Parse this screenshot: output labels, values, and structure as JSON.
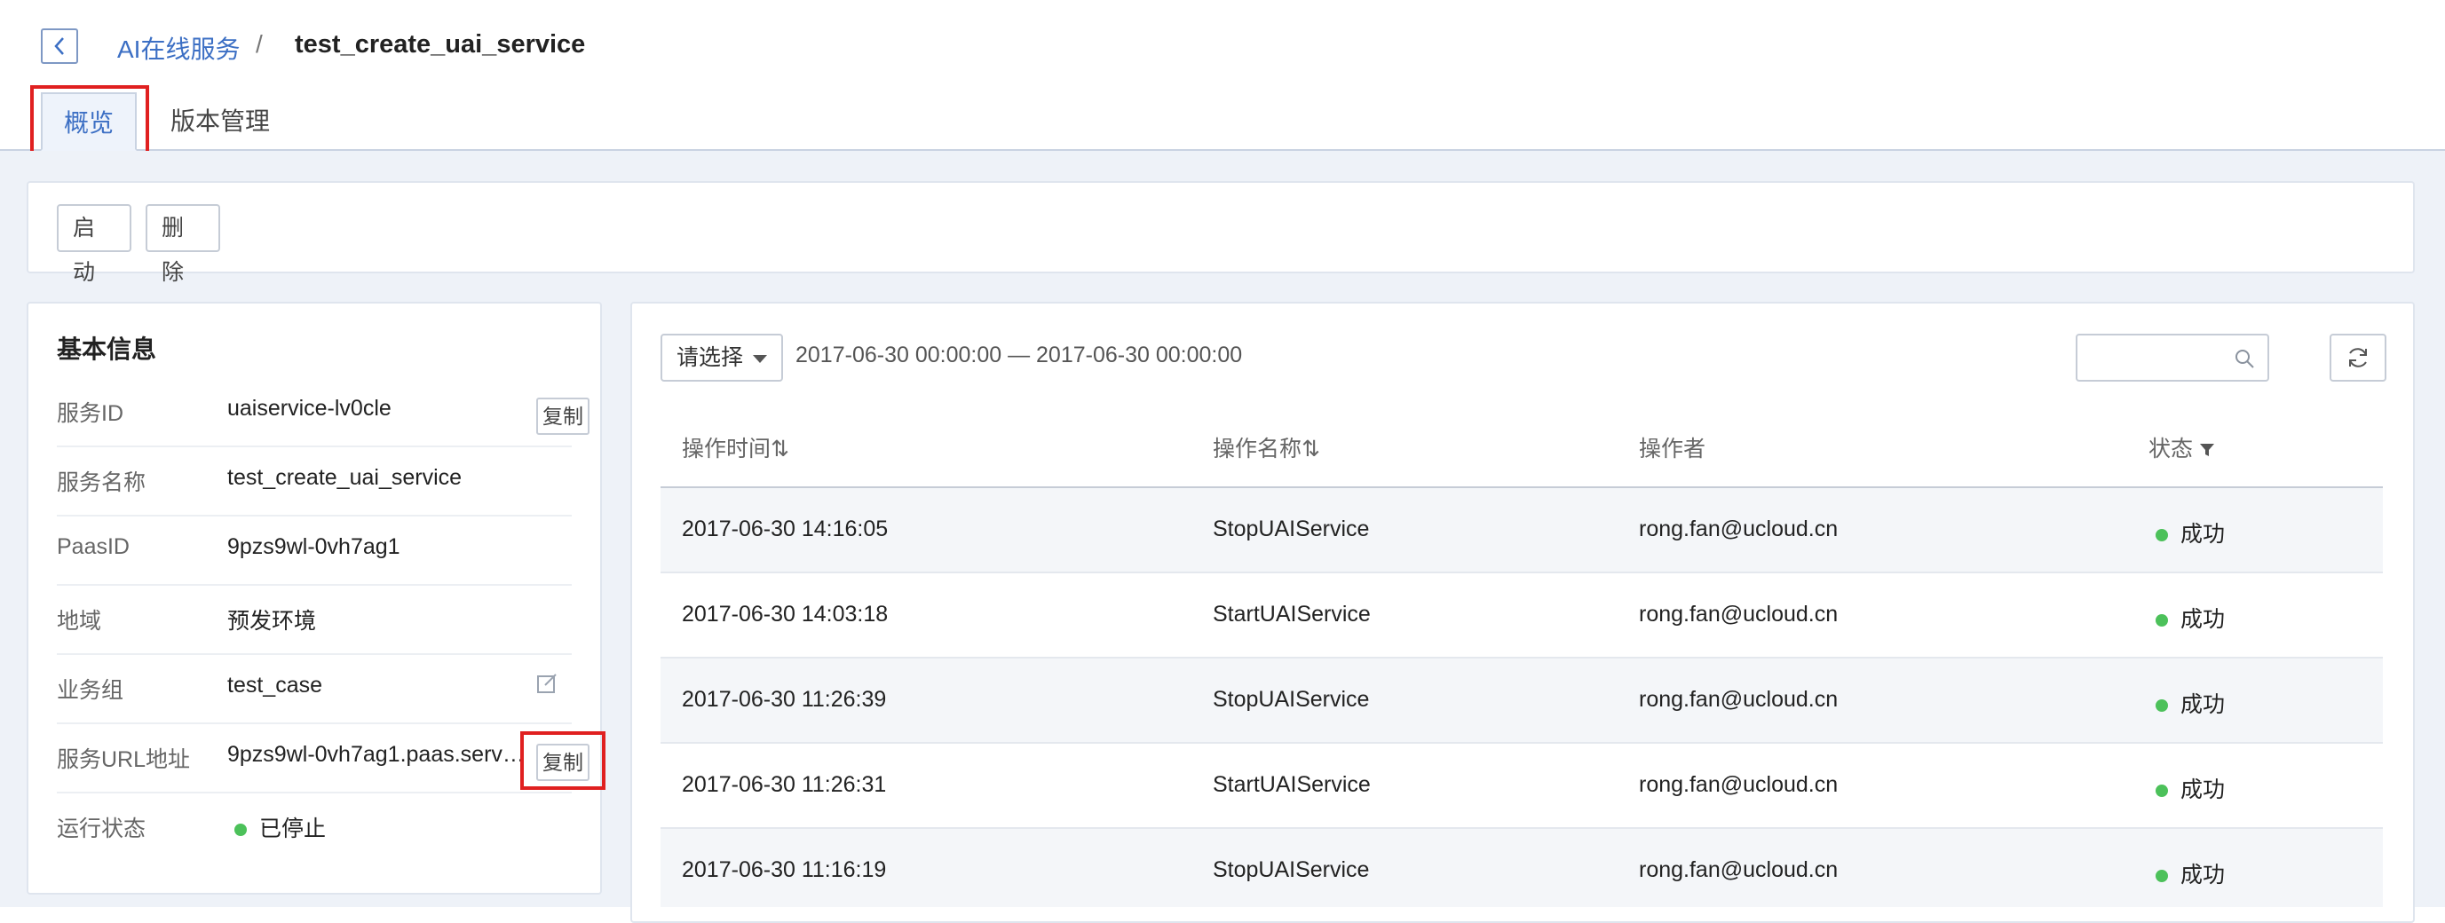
{
  "header": {
    "breadcrumb_parent": "AI在线服务",
    "breadcrumb_sep": "/",
    "breadcrumb_current": "test_create_uai_service"
  },
  "tabs": [
    {
      "label": "概览",
      "active": true
    },
    {
      "label": "版本管理",
      "active": false
    }
  ],
  "toolbar": {
    "start_label": "启动",
    "delete_label": "删除"
  },
  "info": {
    "title": "基本信息",
    "copy_label": "复制",
    "rows": [
      {
        "label": "服务ID",
        "value": "uaiservice-lv0cle"
      },
      {
        "label": "服务名称",
        "value": "test_create_uai_service"
      },
      {
        "label": "PaasID",
        "value": "9pzs9wl-0vh7ag1"
      },
      {
        "label": "地域",
        "value": "预发环境"
      },
      {
        "label": "业务组",
        "value": "test_case"
      },
      {
        "label": "服务URL地址",
        "value": "9pzs9wl-0vh7ag1.paas.servic..."
      },
      {
        "label": "运行状态",
        "value": "已停止"
      }
    ]
  },
  "log": {
    "select_placeholder": "请选择",
    "date_range": "2017-06-30 00:00:00 — 2017-06-30 00:00:00",
    "columns": [
      "操作时间⇅",
      "操作名称⇅",
      "操作者",
      "状态"
    ],
    "rows": [
      {
        "time": "2017-06-30 14:16:05",
        "name": "StopUAIService",
        "operator": "rong.fan@ucloud.cn",
        "status": "成功"
      },
      {
        "time": "2017-06-30 14:03:18",
        "name": "StartUAIService",
        "operator": "rong.fan@ucloud.cn",
        "status": "成功"
      },
      {
        "time": "2017-06-30 11:26:39",
        "name": "StopUAIService",
        "operator": "rong.fan@ucloud.cn",
        "status": "成功"
      },
      {
        "time": "2017-06-30 11:26:31",
        "name": "StartUAIService",
        "operator": "rong.fan@ucloud.cn",
        "status": "成功"
      },
      {
        "time": "2017-06-30 11:16:19",
        "name": "StopUAIService",
        "operator": "rong.fan@ucloud.cn",
        "status": "成功"
      }
    ]
  },
  "colors": {
    "accent": "#3c6fc4",
    "success": "#4cc15a",
    "highlight": "#e02020"
  }
}
